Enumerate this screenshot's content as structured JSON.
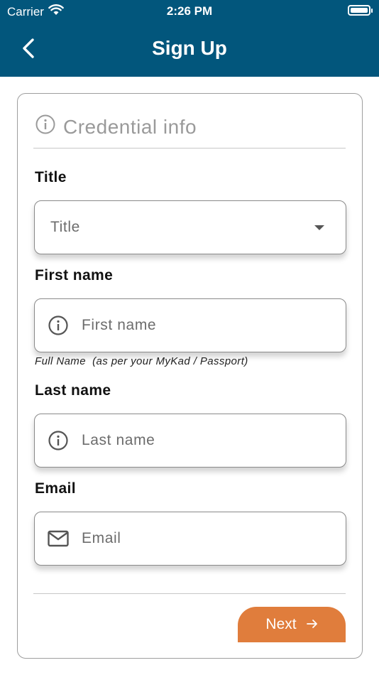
{
  "status_bar": {
    "carrier": "Carrier",
    "time": "2:26 PM"
  },
  "header": {
    "title": "Sign Up"
  },
  "section": {
    "title": "Credential info"
  },
  "form": {
    "title": {
      "label": "Title",
      "placeholder": "Title"
    },
    "first_name": {
      "label": "First name",
      "placeholder": "First name",
      "hint": "Full Name  (as per your MyKad / Passport)"
    },
    "last_name": {
      "label": "Last name",
      "placeholder": "Last name"
    },
    "email": {
      "label": "Email",
      "placeholder": "Email"
    }
  },
  "actions": {
    "next_label": "Next",
    "next_icon": "arrow-right-icon"
  },
  "colors": {
    "header_bg": "#02567c",
    "accent": "#e07d3c"
  }
}
